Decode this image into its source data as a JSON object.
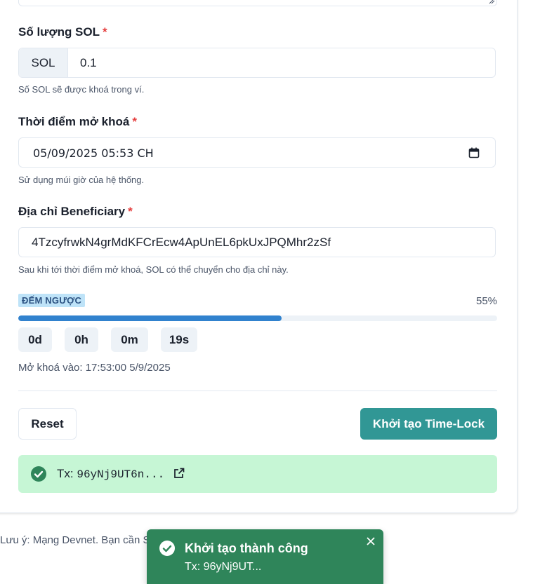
{
  "form": {
    "amount": {
      "label": "Số lượng SOL",
      "required_mark": "*",
      "addon": "SOL",
      "value": "0.1",
      "help": "Số SOL sẽ được khoá trong ví."
    },
    "unlock_time": {
      "label": "Thời điểm mở khoá",
      "required_mark": "*",
      "value": "05/09/2025 05:53 CH",
      "help": "Sử dụng múi giờ của hệ thống."
    },
    "beneficiary": {
      "label": "Địa chỉ Beneficiary",
      "required_mark": "*",
      "value": "4TzcyfrwkN4grMdKFCrEcw4ApUnEL6pkUxJPQMhr2zSf",
      "help": "Sau khi tới thời điểm mở khoá, SOL có thể chuyển cho địa chỉ này."
    }
  },
  "countdown": {
    "badge": "ĐẾM NGƯỢC",
    "percent_label": "55%",
    "progress_fraction": 0.55,
    "days": "0d",
    "hours": "0h",
    "minutes": "0m",
    "seconds": "19s",
    "unlock_at": "Mở khoá vào: 17:53:00 5/9/2025"
  },
  "actions": {
    "reset_label": "Reset",
    "submit_label": "Khởi tạo Time-Lock"
  },
  "alert": {
    "prefix": "Tx:",
    "tx": "96yNj9UT6n...",
    "icons": [
      "check-circle-icon",
      "external-link-icon"
    ]
  },
  "footer_note": "Lưu ý: Mạng Devnet. Bạn cần S",
  "toast": {
    "title": "Khởi tạo thành công",
    "description": "Tx: 96yNj9UT...",
    "icons": [
      "check-circle-icon",
      "close-icon"
    ]
  },
  "colors": {
    "accent": "#319795",
    "progress": "#3182ce",
    "success_bg": "#c6f6d5",
    "toast_bg": "#2f855a",
    "required": "#e53e3e"
  }
}
